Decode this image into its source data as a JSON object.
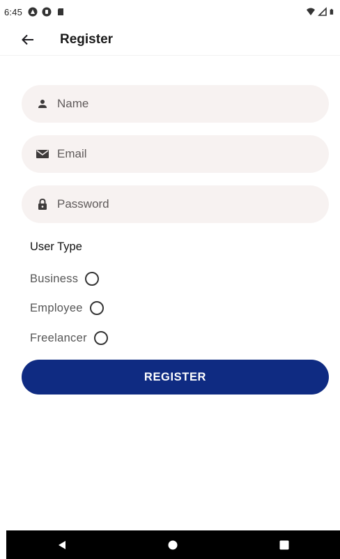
{
  "status_bar": {
    "time": "6:45",
    "left_icons": [
      "app-a-icon",
      "app-p-icon",
      "sd-card-icon"
    ],
    "right_icons": [
      "wifi-icon",
      "signal-icon",
      "battery-icon"
    ]
  },
  "app_bar": {
    "title": "Register",
    "back_icon": "arrow-left-icon"
  },
  "form": {
    "name": {
      "placeholder": "Name",
      "value": "",
      "icon": "person-icon"
    },
    "email": {
      "placeholder": "Email",
      "value": "",
      "icon": "mail-icon"
    },
    "password": {
      "placeholder": "Password",
      "value": "",
      "icon": "lock-icon"
    },
    "user_type_label": "User Type",
    "user_types": [
      {
        "label": "Business",
        "selected": false
      },
      {
        "label": "Employee",
        "selected": false
      },
      {
        "label": "Freelancer",
        "selected": false
      }
    ],
    "register_label": "REGISTER"
  },
  "colors": {
    "primary": "#0f2b82",
    "field_bg": "#f7f2f1",
    "nav_bar": "#000000"
  }
}
